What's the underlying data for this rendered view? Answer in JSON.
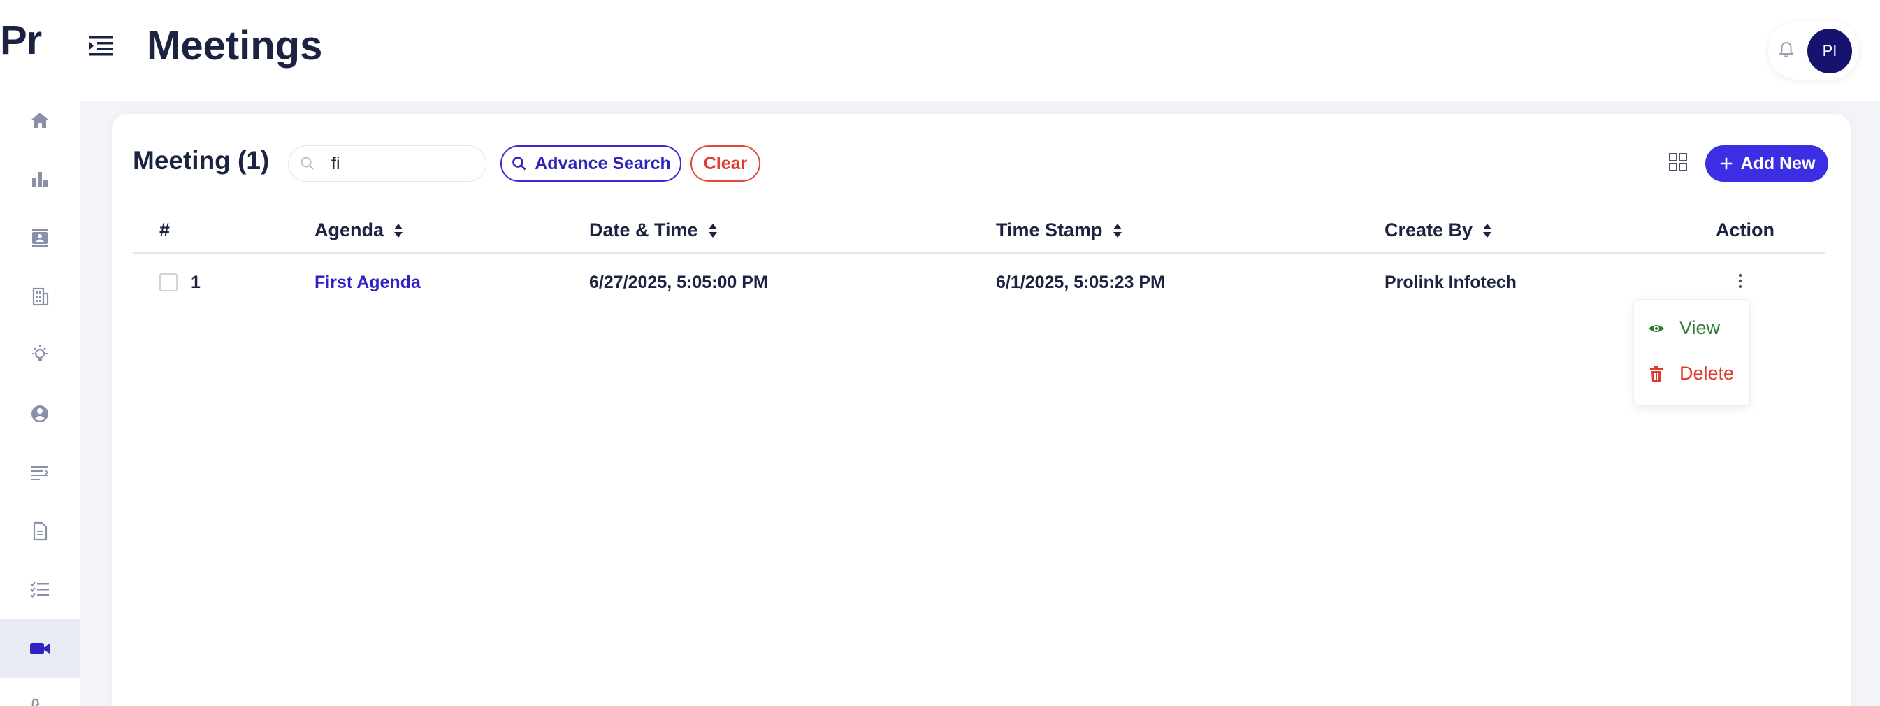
{
  "app": {
    "logo_text": "Pr"
  },
  "header": {
    "title": "Meetings",
    "avatar_initials": "PI"
  },
  "sidebar": {
    "items": [
      {
        "icon": "home-icon",
        "active": false
      },
      {
        "icon": "bar-chart-icon",
        "active": false
      },
      {
        "icon": "contacts-icon",
        "active": false
      },
      {
        "icon": "building-icon",
        "active": false
      },
      {
        "icon": "lightbulb-icon",
        "active": false
      },
      {
        "icon": "user-circle-icon",
        "active": false
      },
      {
        "icon": "text-list-icon",
        "active": false
      },
      {
        "icon": "document-icon",
        "active": false
      },
      {
        "icon": "checklist-icon",
        "active": false
      },
      {
        "icon": "video-camera-icon",
        "active": true
      },
      {
        "icon": "phone-icon",
        "active": false
      }
    ]
  },
  "toolbar": {
    "title": "Meeting (1)",
    "search_value": "fi",
    "advance_search_label": "Advance Search",
    "clear_label": "Clear",
    "add_new_label": "Add New"
  },
  "table": {
    "columns": [
      "#",
      "Agenda",
      "Date & Time",
      "Time Stamp",
      "Create By",
      "Action"
    ],
    "rows": [
      {
        "number": "1",
        "agenda": "First Agenda",
        "date_time": "6/27/2025, 5:05:00 PM",
        "time_stamp": "6/1/2025, 5:05:23 PM",
        "create_by": "Prolink Infotech"
      }
    ]
  },
  "action_menu": {
    "view_label": "View",
    "delete_label": "Delete"
  },
  "colors": {
    "primary": "#3b2ee3",
    "brand_dark": "#16136e",
    "text": "#1c2340",
    "danger": "#e03a2d",
    "success": "#2e7d32",
    "sidebar_icon": "#8a90a8"
  }
}
